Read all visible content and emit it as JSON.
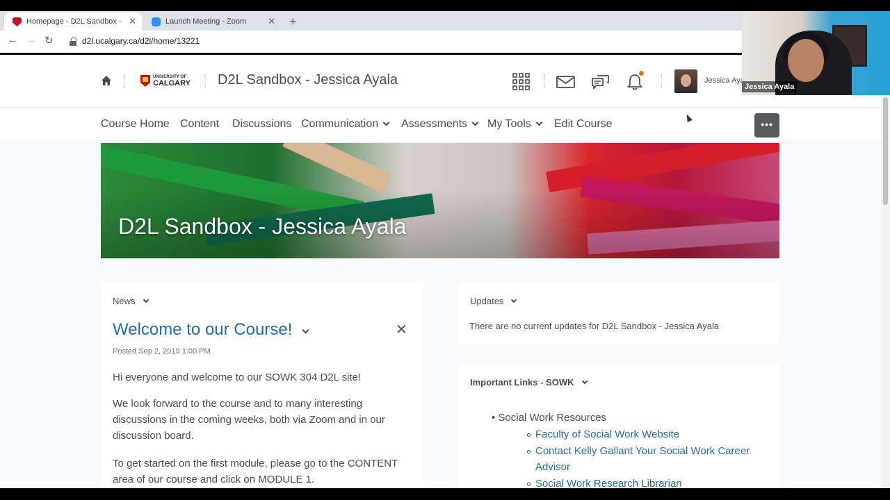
{
  "browser": {
    "tabs": [
      {
        "label": "Homepage - D2L Sandbox - Jessica Ayala",
        "active": true
      },
      {
        "label": "Launch Meeting - Zoom",
        "active": false
      }
    ],
    "url": "d2l.ucalgary.ca/d2l/home/13221"
  },
  "minibar": {
    "logo_top": "UNIVERSITY OF",
    "logo_bottom": "CALGARY",
    "course_title": "D2L Sandbox - Jessica Ayala",
    "user_name": "Jessica Aya"
  },
  "navbar": {
    "items": [
      {
        "label": "Course Home"
      },
      {
        "label": "Content"
      },
      {
        "label": "Discussions"
      },
      {
        "label": "Communication"
      },
      {
        "label": "Assessments"
      },
      {
        "label": "My Tools"
      },
      {
        "label": "Edit Course"
      }
    ],
    "more_label": "•••"
  },
  "banner": {
    "title": "D2L Sandbox - Jessica Ayala"
  },
  "news": {
    "header": "News",
    "title": "Welcome to our Course!",
    "posted": "Posted Sep 2, 2019 1:00 PM",
    "paragraphs": [
      "Hi everyone and welcome to our SOWK 304 D2L site!",
      "We look forward to the course and to many interesting discussions in the coming weeks, both via Zoom and in our discussion board.",
      "To get started on the first module, please go to the CONTENT area of our course and click on MODULE 1."
    ]
  },
  "updates": {
    "header": "Updates",
    "text": "There are no current updates for D2L Sandbox - Jessica Ayala"
  },
  "links": {
    "header": "Important Links - SOWK",
    "group": "Social Work Resources",
    "items": [
      "Faculty of Social Work Website",
      "Contact Kelly Gallant Your Social Work Career Advisor",
      "Social Work Research Librarian"
    ]
  },
  "video": {
    "participant": "Jessica Ayala"
  },
  "colors": {
    "link": "#1e6ea7",
    "text": "#494c4e",
    "notification": "#e87511"
  }
}
